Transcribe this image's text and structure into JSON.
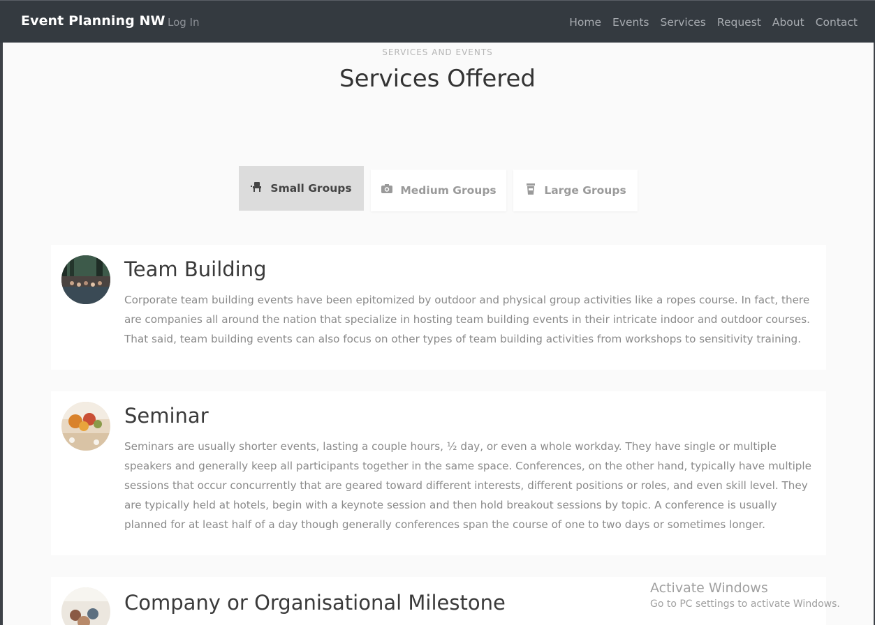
{
  "navbar": {
    "brand": "Event Planning NW",
    "login": "Log In",
    "links": [
      "Home",
      "Events",
      "Services",
      "Request",
      "About",
      "Contact"
    ]
  },
  "section": {
    "subheading": "Services and Events",
    "heading": "Services Offered"
  },
  "tabs": [
    {
      "label": "Small Groups",
      "icon": "chair-icon",
      "active": true
    },
    {
      "label": "Medium Groups",
      "icon": "camera-icon",
      "active": false
    },
    {
      "label": "Large Groups",
      "icon": "trash-icon",
      "active": false
    }
  ],
  "services": [
    {
      "title": "Team Building",
      "text": "Corporate team building events have been epitomized by outdoor and physical group activities like a ropes course. In fact, there are companies all around the nation that specialize in hosting team building events in their intricate indoor and outdoor courses. That said, team building events can also focus on other types of team building activities from workshops to sensitivity training."
    },
    {
      "title": "Seminar",
      "text": "Seminars are usually shorter events, lasting a couple hours, ½ day, or even a whole workday. They have single or multiple speakers and generally keep all participants together in the same space. Conferences, on the other hand, typically have multiple sessions that occur concurrently that are geared toward different interests, different positions or roles, and even skill level. They are typically held at hotels, begin with a keynote session and then hold breakout sessions by topic. A conference is usually planned for at least half of a day though generally conferences span the course of one to two days or sometimes longer."
    },
    {
      "title": "Company or Organisational Milestone",
      "text": ""
    }
  ],
  "watermark": {
    "line1": "Activate Windows",
    "line2": "Go to PC settings to activate Windows."
  }
}
